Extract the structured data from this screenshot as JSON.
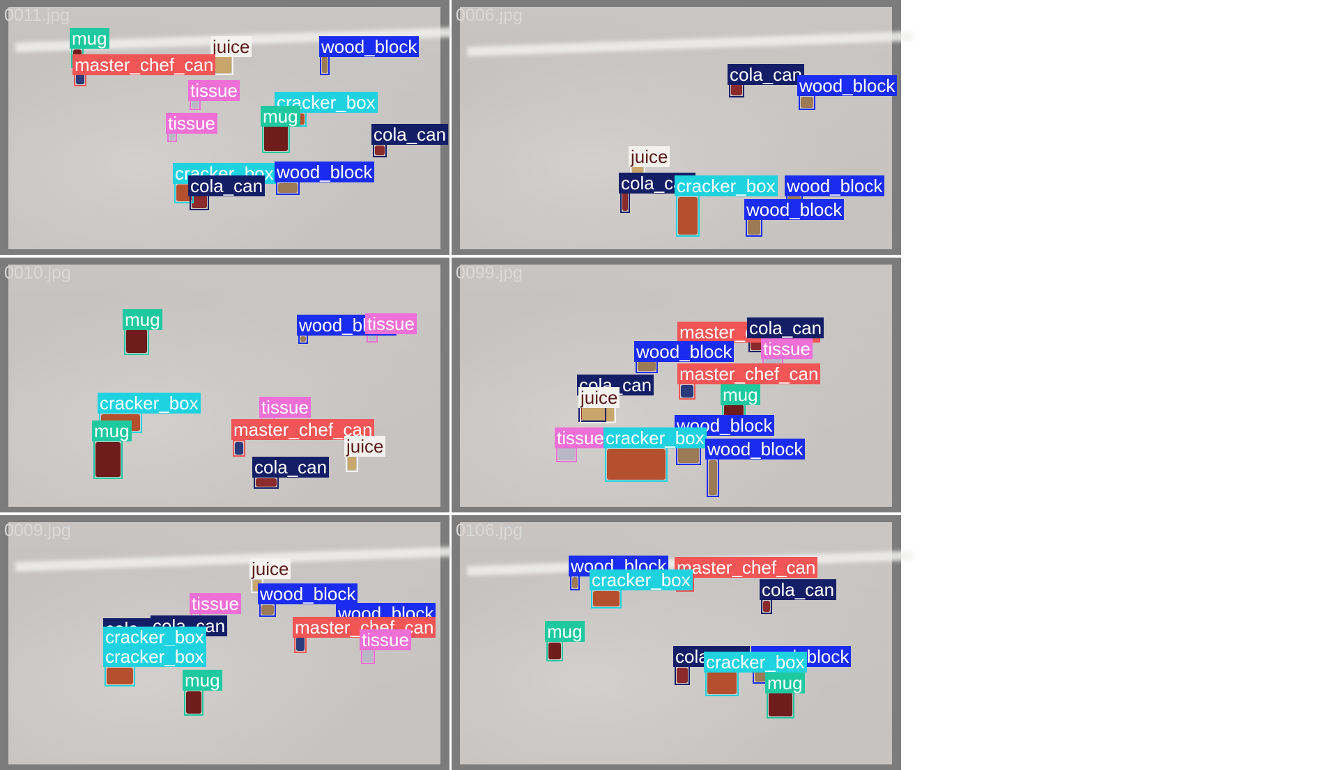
{
  "colors": {
    "mug": "#1fc9a0",
    "juice": "#f4f2ee",
    "master_chef_can": "#f25555",
    "tissue": "#ee6fd6",
    "cracker_box": "#1fd2e0",
    "wood_block": "#1a2cf0",
    "cola_can": "#141e66"
  },
  "label_text_colors": {
    "juice": "#5a1a1a",
    "default": "#ffffff"
  },
  "tiles": [
    {
      "filename": "0011.jpg",
      "detections": [
        {
          "cls": "mug",
          "label": "mug"
        },
        {
          "cls": "juice",
          "label": "juice"
        },
        {
          "cls": "master_chef_can",
          "label": "master_chef_can"
        },
        {
          "cls": "wood_block",
          "label": "wood_block"
        },
        {
          "cls": "tissue",
          "label": "tissue"
        },
        {
          "cls": "cracker_box",
          "label": "cracker_box"
        },
        {
          "cls": "mug",
          "label": "mug"
        },
        {
          "cls": "tissue",
          "label": "tissue"
        },
        {
          "cls": "cola_can",
          "label": "cola_can"
        },
        {
          "cls": "cracker_box",
          "label": "cracker_box"
        },
        {
          "cls": "wood_block",
          "label": "wood_block"
        },
        {
          "cls": "cola_can",
          "label": "cola_can"
        }
      ]
    },
    {
      "filename": "0006.jpg",
      "detections": [
        {
          "cls": "cola_can",
          "label": "cola_can"
        },
        {
          "cls": "wood_block",
          "label": "wood_block"
        },
        {
          "cls": "juice",
          "label": "juice"
        },
        {
          "cls": "cola_can",
          "label": "cola_can"
        },
        {
          "cls": "cracker_box",
          "label": "cracker_box"
        },
        {
          "cls": "wood_block",
          "label": "wood_block"
        },
        {
          "cls": "wood_block",
          "label": "wood_block"
        }
      ]
    },
    {
      "filename": "0010.jpg",
      "detections": [
        {
          "cls": "mug",
          "label": "mug"
        },
        {
          "cls": "wood_block",
          "label": "wood_block"
        },
        {
          "cls": "tissue",
          "label": "tissue"
        },
        {
          "cls": "cracker_box",
          "label": "cracker_box"
        },
        {
          "cls": "tissue",
          "label": "tissue"
        },
        {
          "cls": "mug",
          "label": "mug"
        },
        {
          "cls": "master_chef_can",
          "label": "master_chef_can"
        },
        {
          "cls": "juice",
          "label": "juice"
        },
        {
          "cls": "cola_can",
          "label": "cola_can"
        }
      ]
    },
    {
      "filename": "0099.jpg",
      "detections": [
        {
          "cls": "master_chef_can",
          "label": "master_chef_can"
        },
        {
          "cls": "cola_can",
          "label": "cola_can"
        },
        {
          "cls": "wood_block",
          "label": "wood_block"
        },
        {
          "cls": "tissue",
          "label": "tissue"
        },
        {
          "cls": "master_chef_can",
          "label": "master_chef_can"
        },
        {
          "cls": "cola_can",
          "label": "cola_can"
        },
        {
          "cls": "juice",
          "label": "juice"
        },
        {
          "cls": "mug",
          "label": "mug"
        },
        {
          "cls": "wood_block",
          "label": "wood_block"
        },
        {
          "cls": "tissue",
          "label": "tissue"
        },
        {
          "cls": "cracker_box",
          "label": "cracker_box"
        },
        {
          "cls": "wood_block",
          "label": "wood_block"
        }
      ]
    },
    {
      "filename": "0009.jpg",
      "detections": [
        {
          "cls": "juice",
          "label": "juice"
        },
        {
          "cls": "wood_block",
          "label": "wood_block"
        },
        {
          "cls": "tissue",
          "label": "tissue"
        },
        {
          "cls": "wood_block",
          "label": "wood_block"
        },
        {
          "cls": "cola_can",
          "label": "cola_can"
        },
        {
          "cls": "cola_can",
          "label": "cola_can"
        },
        {
          "cls": "master_chef_can",
          "label": "master_chef_can"
        },
        {
          "cls": "tissue",
          "label": "tissue"
        },
        {
          "cls": "cracker_box",
          "label": "cracker_box"
        },
        {
          "cls": "cracker_box",
          "label": "cracker_box"
        },
        {
          "cls": "mug",
          "label": "mug"
        }
      ]
    },
    {
      "filename": "0106.jpg",
      "detections": [
        {
          "cls": "wood_block",
          "label": "wood_block"
        },
        {
          "cls": "master_chef_can",
          "label": "master_chef_can"
        },
        {
          "cls": "cracker_box",
          "label": "cracker_box"
        },
        {
          "cls": "cola_can",
          "label": "cola_can"
        },
        {
          "cls": "mug",
          "label": "mug"
        },
        {
          "cls": "cola_can",
          "label": "cola_can"
        },
        {
          "cls": "wood_block",
          "label": "wood_block"
        },
        {
          "cls": "cracker_box",
          "label": "cracker_box"
        },
        {
          "cls": "mug",
          "label": "mug"
        }
      ]
    }
  ]
}
